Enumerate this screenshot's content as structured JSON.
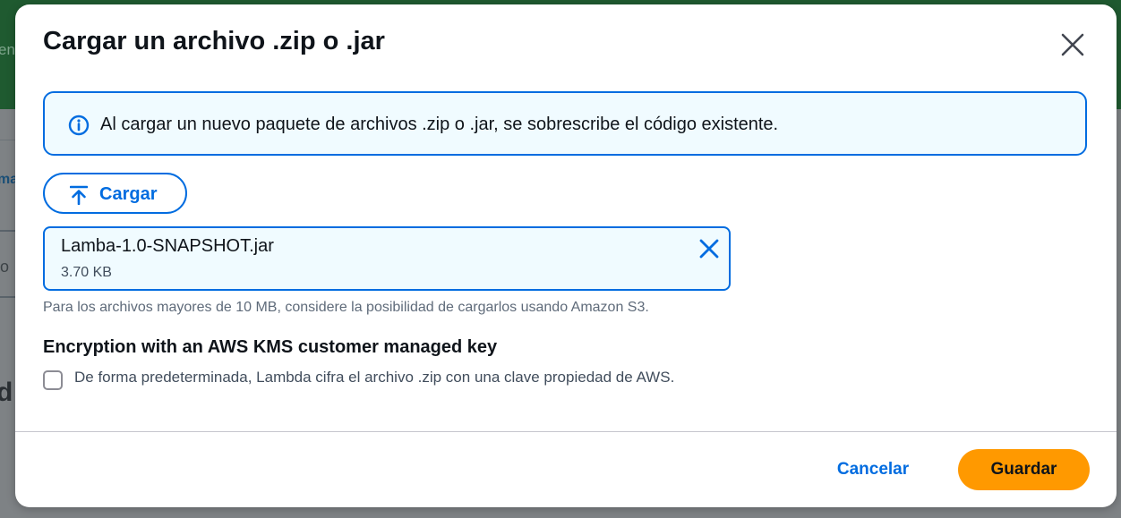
{
  "background": {
    "fragments": {
      "green_text": "en",
      "tab_text": "ma",
      "row_text": "o",
      "heading_text": "d"
    }
  },
  "modal": {
    "title": "Cargar un archivo .zip o .jar",
    "close_icon": "close-icon",
    "alert": {
      "icon": "info-icon",
      "text": "Al cargar un nuevo paquete de archivos .zip o .jar, se sobrescribe el código existente."
    },
    "upload_button": {
      "icon": "upload-icon",
      "label": "Cargar"
    },
    "file": {
      "name": "Lamba-1.0-SNAPSHOT.jar",
      "size": "3.70 KB",
      "remove_icon": "remove-icon"
    },
    "hint": "Para los archivos mayores de 10 MB, considere la posibilidad de cargarlos usando Amazon S3.",
    "encryption": {
      "title": "Encryption with an AWS KMS customer managed key",
      "checkbox_checked": false,
      "checkbox_label": "De forma predeterminada, Lambda cifra el archivo .zip con una clave propiedad de AWS."
    },
    "footer": {
      "cancel_label": "Cancelar",
      "save_label": "Guardar"
    }
  },
  "colors": {
    "primary": "#006ce0",
    "accent": "#ff9900",
    "alert_background": "#f0fbff",
    "text": "#0f141a"
  }
}
